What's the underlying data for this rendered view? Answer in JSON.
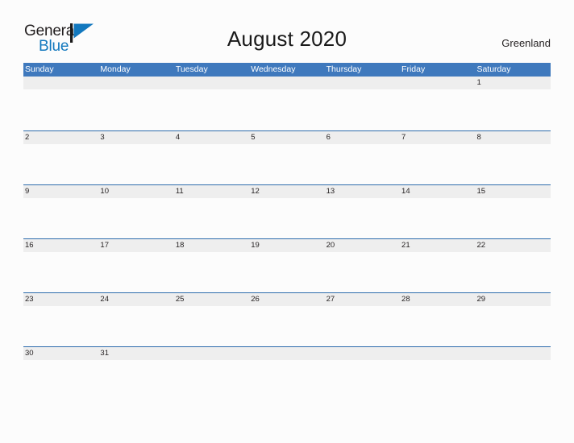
{
  "brand": {
    "word_one": "General",
    "word_two": "Blue",
    "flag_icon": "blue-flag-triangle",
    "color_dark": "#231f20",
    "color_blue": "#1278be"
  },
  "header": {
    "title": "August 2020",
    "location": "Greenland"
  },
  "theme": {
    "header_blue": "#3f79bd",
    "divider_blue": "#2e6cac",
    "band_gray": "#eeeeee",
    "page_background": "#fcfcfc",
    "text_dark": "#231f20"
  },
  "calendar": {
    "month": "August",
    "year": "2020",
    "weekday_headers": [
      "Sunday",
      "Monday",
      "Tuesday",
      "Wednesday",
      "Thursday",
      "Friday",
      "Saturday"
    ],
    "weeks": [
      [
        "",
        "",
        "",
        "",
        "",
        "",
        "1"
      ],
      [
        "2",
        "3",
        "4",
        "5",
        "6",
        "7",
        "8"
      ],
      [
        "9",
        "10",
        "11",
        "12",
        "13",
        "14",
        "15"
      ],
      [
        "16",
        "17",
        "18",
        "19",
        "20",
        "21",
        "22"
      ],
      [
        "23",
        "24",
        "25",
        "26",
        "27",
        "28",
        "29"
      ],
      [
        "30",
        "31",
        "",
        "",
        "",
        "",
        ""
      ]
    ]
  }
}
